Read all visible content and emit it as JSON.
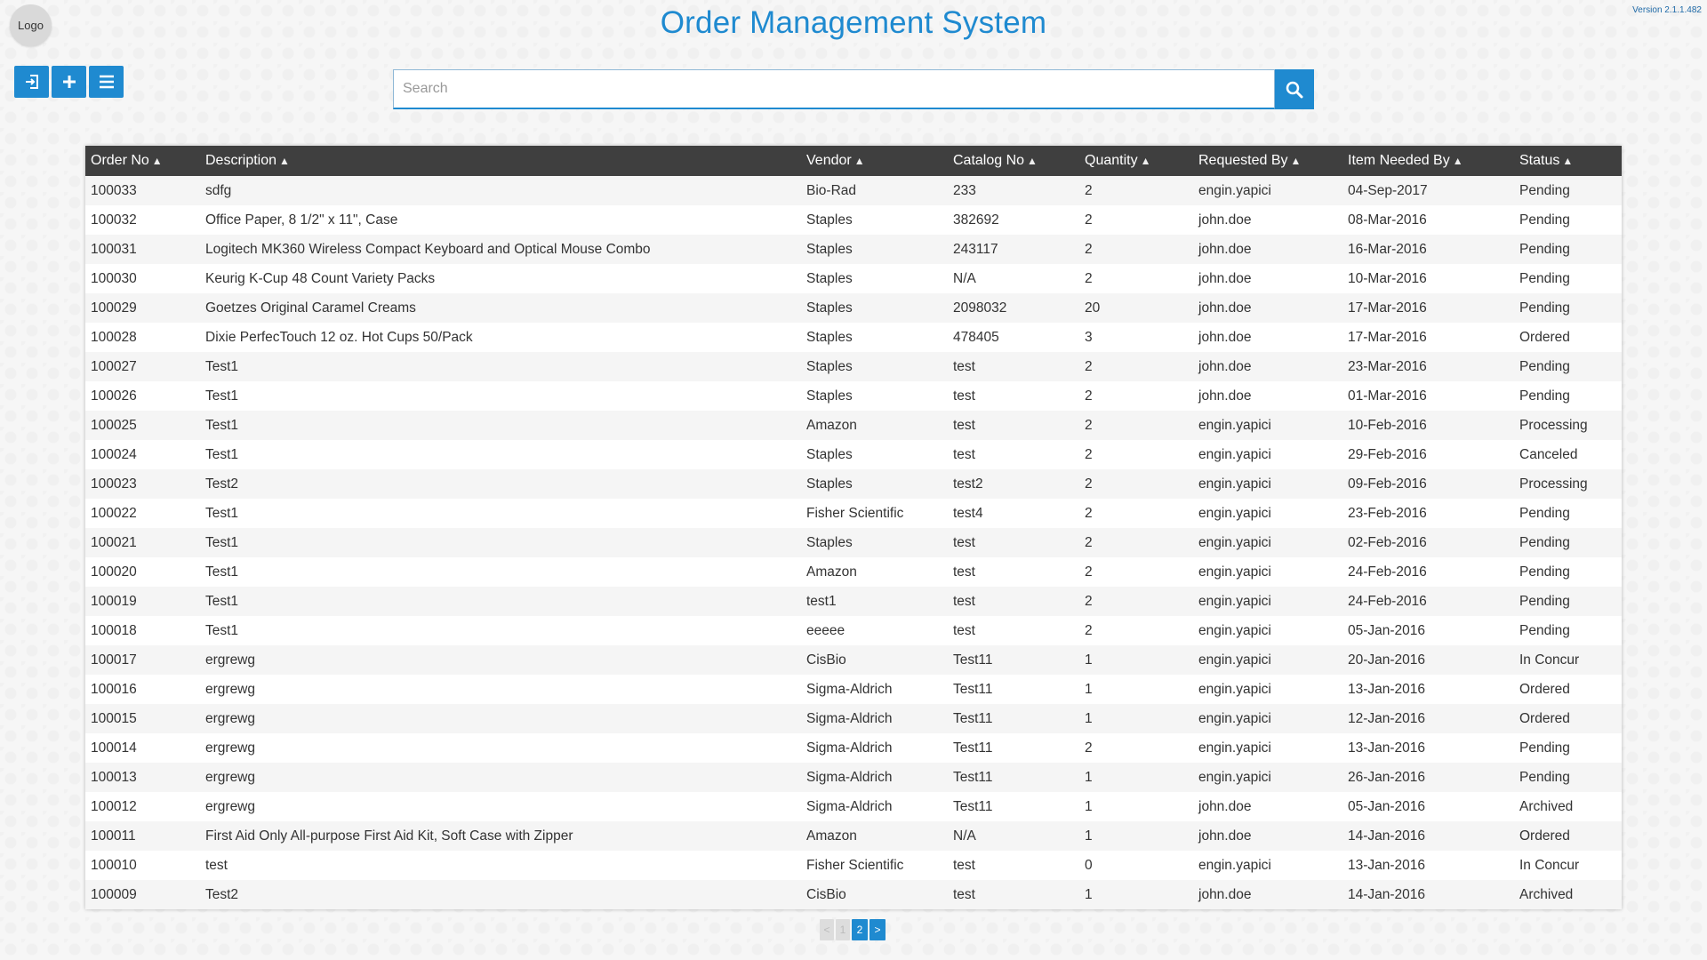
{
  "header": {
    "logo_text": "Logo",
    "title": "Order Management System",
    "version": "Version 2.1.1.482"
  },
  "toolbar": {
    "buttons": [
      {
        "icon": "login-icon"
      },
      {
        "icon": "plus-icon"
      },
      {
        "icon": "menu-icon"
      }
    ]
  },
  "search": {
    "placeholder": "Search",
    "value": "",
    "button_icon": "search-icon"
  },
  "table": {
    "columns": [
      "Order No",
      "Description",
      "Vendor",
      "Catalog No",
      "Quantity",
      "Requested By",
      "Item Needed By",
      "Status"
    ],
    "rows": [
      [
        "100033",
        "sdfg",
        "Bio-Rad",
        "233",
        "2",
        "engin.yapici",
        "04-Sep-2017",
        "Pending"
      ],
      [
        "100032",
        "Office Paper, 8 1/2\" x 11\", Case",
        "Staples",
        "382692",
        "2",
        "john.doe",
        "08-Mar-2016",
        "Pending"
      ],
      [
        "100031",
        "Logitech MK360 Wireless Compact Keyboard and Optical Mouse Combo",
        "Staples",
        "243117",
        "2",
        "john.doe",
        "16-Mar-2016",
        "Pending"
      ],
      [
        "100030",
        "Keurig K-Cup 48 Count Variety Packs",
        "Staples",
        "N/A",
        "2",
        "john.doe",
        "10-Mar-2016",
        "Pending"
      ],
      [
        "100029",
        "Goetzes Original Caramel Creams",
        "Staples",
        "2098032",
        "20",
        "john.doe",
        "17-Mar-2016",
        "Pending"
      ],
      [
        "100028",
        "Dixie PerfecTouch 12 oz. Hot Cups 50/Pack",
        "Staples",
        "478405",
        "3",
        "john.doe",
        "17-Mar-2016",
        "Ordered"
      ],
      [
        "100027",
        "Test1",
        "Staples",
        "test",
        "2",
        "john.doe",
        "23-Mar-2016",
        "Pending"
      ],
      [
        "100026",
        "Test1",
        "Staples",
        "test",
        "2",
        "john.doe",
        "01-Mar-2016",
        "Pending"
      ],
      [
        "100025",
        "Test1",
        "Amazon",
        "test",
        "2",
        "engin.yapici",
        "10-Feb-2016",
        "Processing"
      ],
      [
        "100024",
        "Test1",
        "Staples",
        "test",
        "2",
        "engin.yapici",
        "29-Feb-2016",
        "Canceled"
      ],
      [
        "100023",
        "Test2",
        "Staples",
        "test2",
        "2",
        "engin.yapici",
        "09-Feb-2016",
        "Processing"
      ],
      [
        "100022",
        "Test1",
        "Fisher Scientific",
        "test4",
        "2",
        "engin.yapici",
        "23-Feb-2016",
        "Pending"
      ],
      [
        "100021",
        "Test1",
        "Staples",
        "test",
        "2",
        "engin.yapici",
        "02-Feb-2016",
        "Pending"
      ],
      [
        "100020",
        "Test1",
        "Amazon",
        "test",
        "2",
        "engin.yapici",
        "24-Feb-2016",
        "Pending"
      ],
      [
        "100019",
        "Test1",
        "test1",
        "test",
        "2",
        "engin.yapici",
        "24-Feb-2016",
        "Pending"
      ],
      [
        "100018",
        "Test1",
        "eeeee",
        "test",
        "2",
        "engin.yapici",
        "05-Jan-2016",
        "Pending"
      ],
      [
        "100017",
        "ergrewg",
        "CisBio",
        "Test11",
        "1",
        "engin.yapici",
        "20-Jan-2016",
        "In Concur"
      ],
      [
        "100016",
        "ergrewg",
        "Sigma-Aldrich",
        "Test11",
        "1",
        "engin.yapici",
        "13-Jan-2016",
        "Ordered"
      ],
      [
        "100015",
        "ergrewg",
        "Sigma-Aldrich",
        "Test11",
        "1",
        "engin.yapici",
        "12-Jan-2016",
        "Ordered"
      ],
      [
        "100014",
        "ergrewg",
        "Sigma-Aldrich",
        "Test11",
        "2",
        "engin.yapici",
        "13-Jan-2016",
        "Pending"
      ],
      [
        "100013",
        "ergrewg",
        "Sigma-Aldrich",
        "Test11",
        "1",
        "engin.yapici",
        "26-Jan-2016",
        "Pending"
      ],
      [
        "100012",
        "ergrewg",
        "Sigma-Aldrich",
        "Test11",
        "1",
        "john.doe",
        "05-Jan-2016",
        "Archived"
      ],
      [
        "100011",
        "First Aid Only All-purpose First Aid Kit, Soft Case with Zipper",
        "Amazon",
        "N/A",
        "1",
        "john.doe",
        "14-Jan-2016",
        "Ordered"
      ],
      [
        "100010",
        "test",
        "Fisher Scientific",
        "test",
        "0",
        "engin.yapici",
        "13-Jan-2016",
        "In Concur"
      ],
      [
        "100009",
        "Test2",
        "CisBio",
        "test",
        "1",
        "john.doe",
        "14-Jan-2016",
        "Archived"
      ]
    ]
  },
  "pagination": {
    "prev": "<",
    "page1": "1",
    "current": "2",
    "next": ">"
  },
  "colors": {
    "accent": "#1f8ad0",
    "header_bg": "#3f3f3f"
  }
}
